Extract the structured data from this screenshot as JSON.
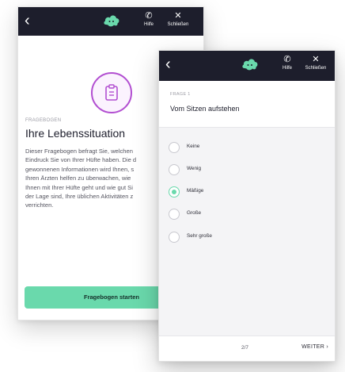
{
  "back_screen": {
    "topbar": {
      "back_glyph": "‹",
      "logo_icon": "cloud-logo",
      "help_label": "Hilfe",
      "close_label": "Schließen"
    },
    "hero_icon": "clipboard-icon",
    "eyebrow": "FRAGEBOGEN",
    "title": "Ihre Lebenssituation",
    "body_lines": [
      "Dieser Fragebogen befragt Sie, welchen",
      "Eindruck Sie von Ihrer Hüfte haben. Die d",
      "gewonnenen Informationen wird Ihnen, s",
      "Ihren Ärzten helfen zu überwachen, wie",
      "Ihnen mit Ihrer Hüfte geht und wie gut Si",
      "der Lage sind, Ihre üblichen Aktivitäten z",
      "verrichten."
    ],
    "start_button": "Fragebogen starten"
  },
  "front_screen": {
    "topbar": {
      "back_glyph": "‹",
      "logo_icon": "cloud-logo",
      "help_label": "Hilfe",
      "close_label": "Schließen"
    },
    "eyebrow": "FRAGE 1",
    "question": "Vom Sitzen aufstehen",
    "options": [
      {
        "label": "Keine",
        "selected": false
      },
      {
        "label": "Wenig",
        "selected": false
      },
      {
        "label": "Mäßige",
        "selected": true
      },
      {
        "label": "Große",
        "selected": false
      },
      {
        "label": "Sehr große",
        "selected": false
      }
    ],
    "footer": {
      "page": "2/7",
      "next_label": "WEITER ›"
    }
  },
  "colors": {
    "topbar": "#1d1e2c",
    "accent_green": "#6ad9ac",
    "accent_purple": "#b24fd1"
  }
}
